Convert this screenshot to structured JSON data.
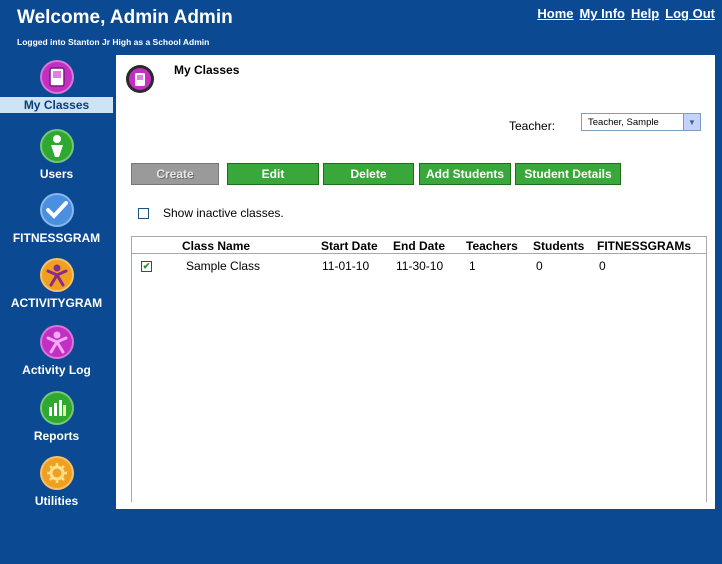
{
  "header": {
    "title": "Welcome, Admin Admin",
    "subtitle": "Logged into Stanton Jr High as a School Admin",
    "links": [
      "Home",
      "My Info",
      "Help",
      "Log Out"
    ]
  },
  "sidebar": {
    "items": [
      {
        "label": "My Classes",
        "icon": "my-classes-icon",
        "color": "#c22fc2",
        "active": true
      },
      {
        "label": "Users",
        "icon": "users-icon",
        "color": "#2fa82f"
      },
      {
        "label": "FITNESSGRAM",
        "icon": "fitnessgram-icon",
        "color": "#4a8fe0"
      },
      {
        "label": "ACTIVITYGRAM",
        "icon": "activitygram-icon",
        "color": "#f0a020"
      },
      {
        "label": "Activity Log",
        "icon": "activity-log-icon",
        "color": "#c22fc2"
      },
      {
        "label": "Reports",
        "icon": "reports-icon",
        "color": "#2fa82f"
      },
      {
        "label": "Utilities",
        "icon": "utilities-icon",
        "color": "#f0a020"
      }
    ]
  },
  "main": {
    "title": "My Classes",
    "teacher_label": "Teacher:",
    "teacher_value": "Teacher, Sample",
    "buttons": {
      "create": "Create",
      "edit": "Edit",
      "delete": "Delete",
      "add_students": "Add Students",
      "student_details": "Student Details"
    },
    "show_inactive_label": "Show inactive classes.",
    "table": {
      "columns": [
        "Class Name",
        "Start Date",
        "End Date",
        "Teachers",
        "Students",
        "FITNESSGRAMs"
      ],
      "rows": [
        {
          "checked": true,
          "cells": [
            "Sample Class",
            "11-01-10",
            "11-30-10",
            "1",
            "0",
            "0"
          ]
        }
      ]
    }
  },
  "colors": {
    "background": "#0b4a92",
    "button_green": "#39a739",
    "button_disabled": "#9a9a9a",
    "active_nav": "#cfe3f7"
  }
}
